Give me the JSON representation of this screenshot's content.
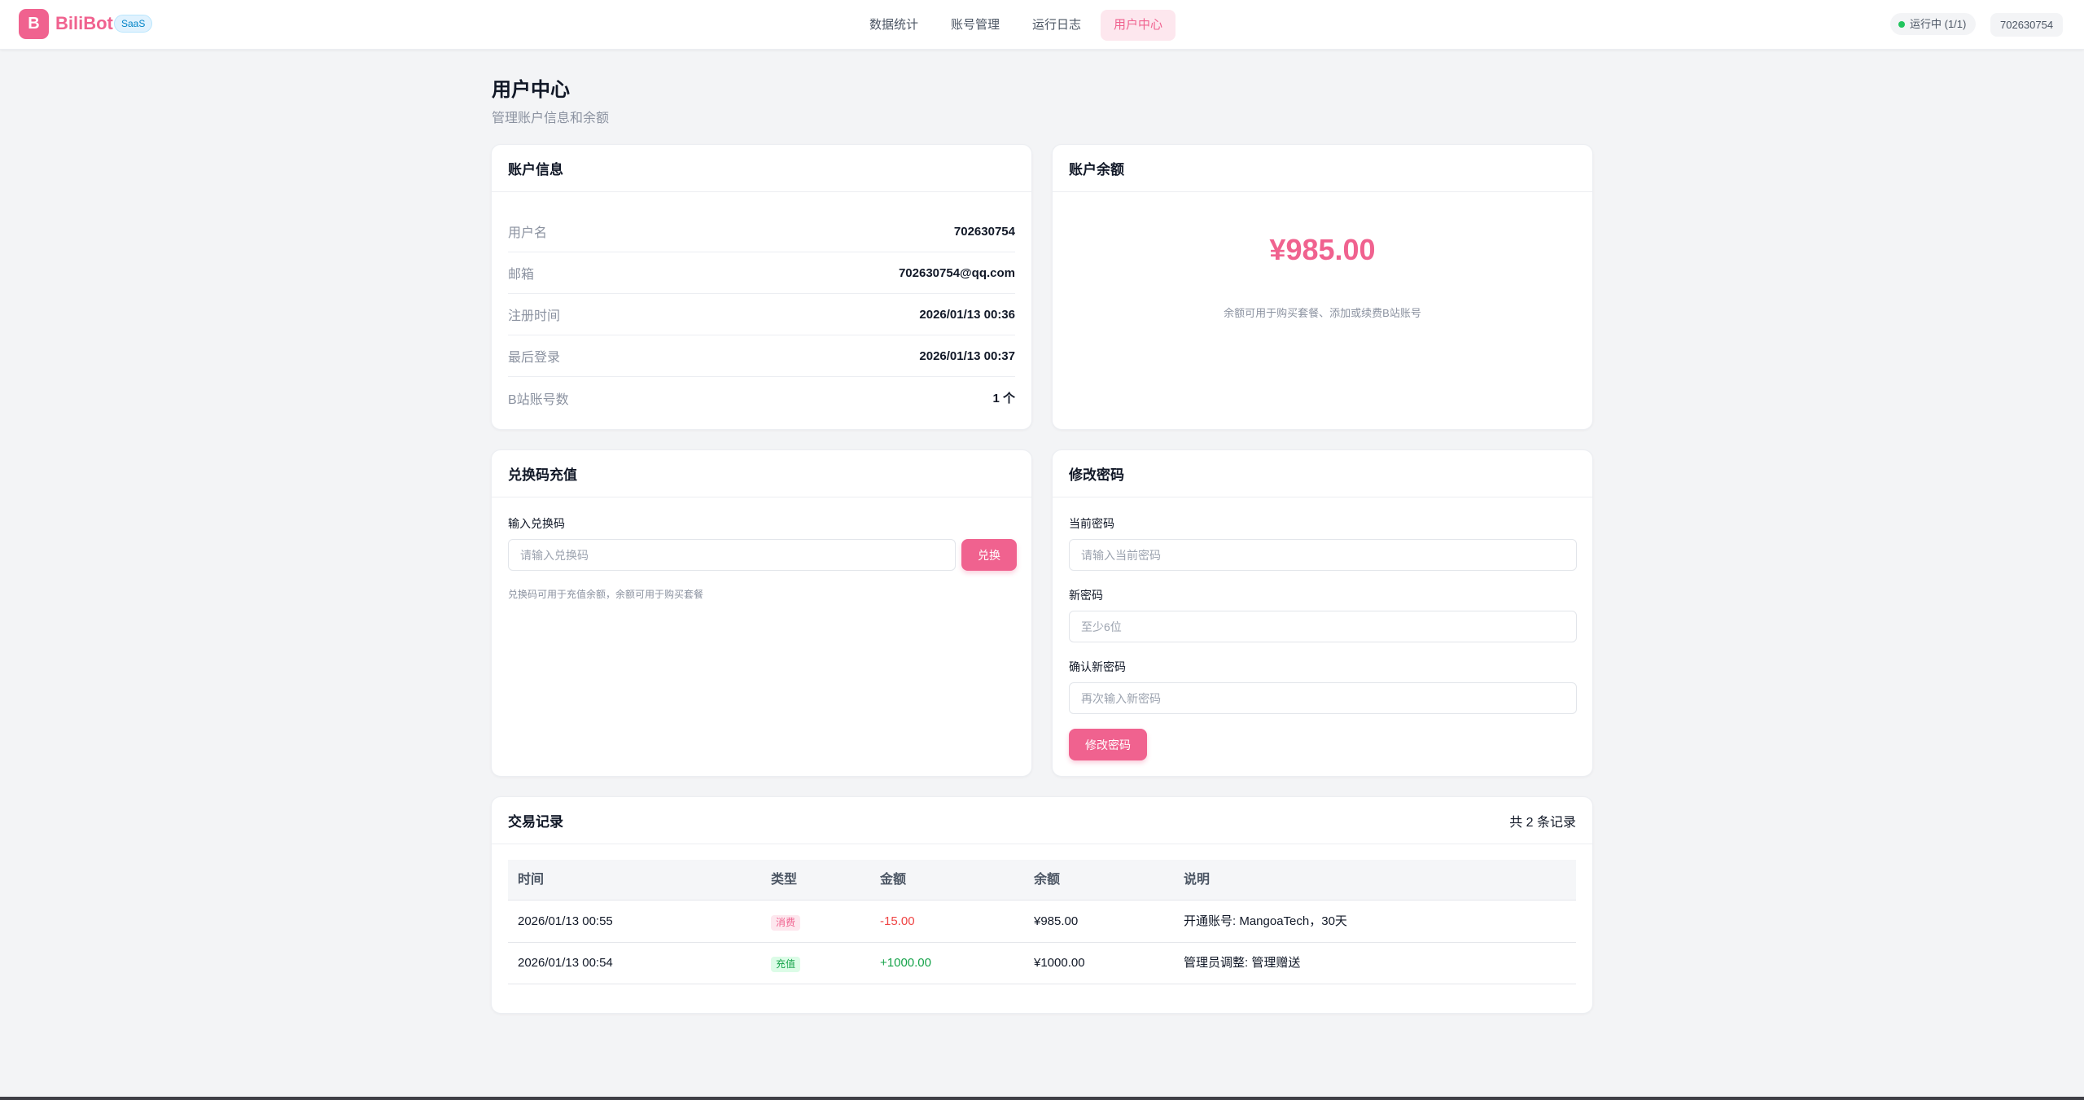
{
  "header": {
    "logo_letter": "B",
    "brand": "BiliBot",
    "badge": "SaaS",
    "nav": [
      "数据统计",
      "账号管理",
      "运行日志",
      "用户中心"
    ],
    "active_nav": "用户中心",
    "status": "运行中 (1/1)",
    "status_color": "#22c55e",
    "user": "702630754"
  },
  "page": {
    "title": "用户中心",
    "subtitle": "管理账户信息和余额"
  },
  "account_info": {
    "title": "账户信息",
    "rows": [
      {
        "label": "用户名",
        "value": "702630754"
      },
      {
        "label": "邮箱",
        "value": "702630754@qq.com"
      },
      {
        "label": "注册时间",
        "value": "2026/01/13 00:36"
      },
      {
        "label": "最后登录",
        "value": "2026/01/13 00:37"
      },
      {
        "label": "B站账号数",
        "value": "1 个"
      }
    ]
  },
  "balance_card": {
    "title": "账户余额",
    "amount": "¥985.00",
    "note": "余额可用于购买套餐、添加或续费B站账号",
    "accent": "#f0628f"
  },
  "redeem": {
    "title": "兑换码充值",
    "label": "输入兑换码",
    "placeholder": "请输入兑换码",
    "button": "兑换",
    "hint": "兑换码可用于充值余额，余额可用于购买套餐"
  },
  "password": {
    "title": "修改密码",
    "current_label": "当前密码",
    "current_placeholder": "请输入当前密码",
    "new_label": "新密码",
    "new_placeholder": "至少6位",
    "confirm_label": "确认新密码",
    "confirm_placeholder": "再次输入新密码",
    "button": "修改密码"
  },
  "transactions": {
    "title": "交易记录",
    "count": "共 2 条记录",
    "columns": [
      "时间",
      "类型",
      "金额",
      "余额",
      "说明"
    ],
    "rows": [
      {
        "time": "2026/01/13 00:55",
        "type": "消费",
        "amount": "-15.00",
        "balance": "¥985.00",
        "desc": "开通账号: MangoaTech，30天"
      },
      {
        "time": "2026/01/13 00:54",
        "type": "充值",
        "amount": "+1000.00",
        "balance": "¥1000.00",
        "desc": "管理员调整: 管理赠送"
      }
    ]
  }
}
